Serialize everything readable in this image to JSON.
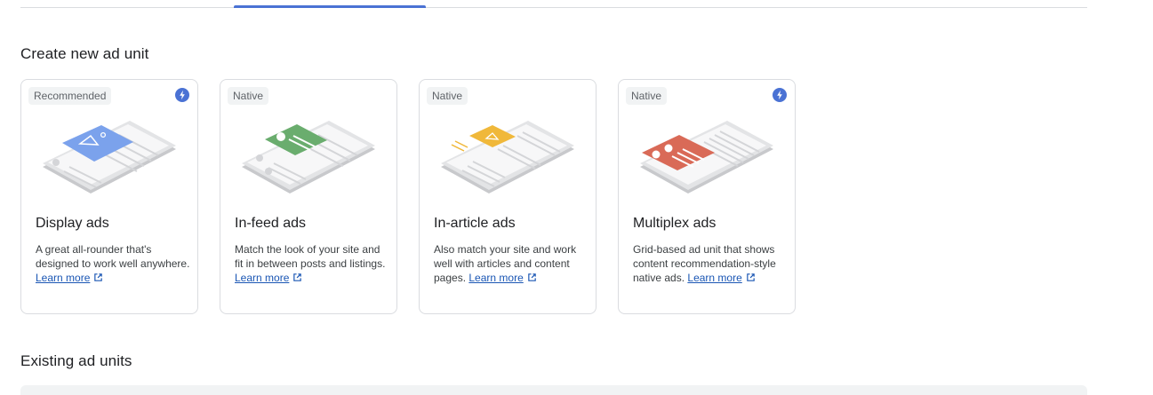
{
  "sections": {
    "create_title": "Create new ad unit",
    "existing_title": "Existing ad units"
  },
  "cards": [
    {
      "badge": "Recommended",
      "has_bolt": true,
      "title": "Display ads",
      "description": "A great all-rounder that's designed to work well anywhere.",
      "link": "Learn more",
      "accent": "#7ba2ec",
      "icon": "display-ads-illustration"
    },
    {
      "badge": "Native",
      "has_bolt": false,
      "title": "In-feed ads",
      "description": "Match the look of your site and fit in between posts and listings.",
      "link": "Learn more",
      "accent": "#6aad6e",
      "icon": "in-feed-ads-illustration"
    },
    {
      "badge": "Native",
      "has_bolt": false,
      "title": "In-article ads",
      "description": "Also match your site and work well with articles and content pages.",
      "link": "Learn more",
      "accent": "#f0b83a",
      "icon": "in-article-ads-illustration"
    },
    {
      "badge": "Native",
      "has_bolt": true,
      "title": "Multiplex ads",
      "description": "Grid-based ad unit that shows content recommendation-style native ads.",
      "link": "Learn more",
      "accent": "#d96a57",
      "icon": "multiplex-ads-illustration"
    }
  ],
  "colors": {
    "link": "#1a56b4",
    "bolt": "#4a72d4",
    "tab_indicator": "#4a72d4"
  }
}
